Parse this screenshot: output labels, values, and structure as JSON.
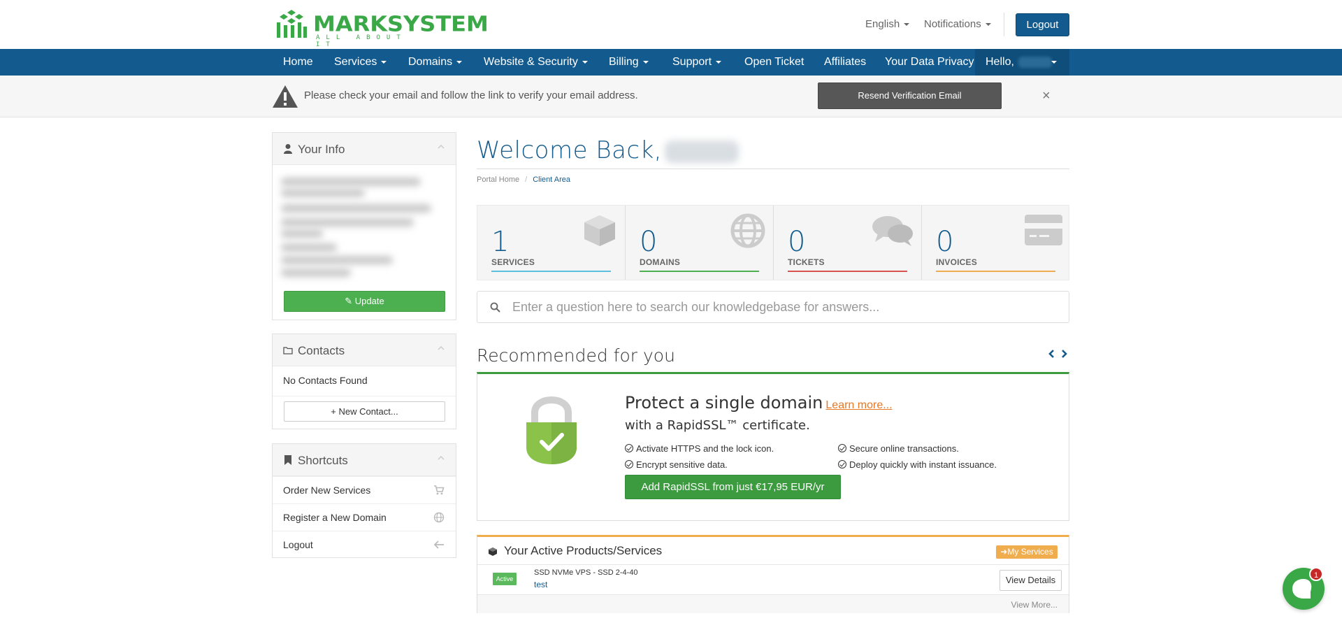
{
  "brand": {
    "logo_text": "MARKSYSTEM",
    "tagline": "ALL ABOUT IT",
    "primary_color": "#135b8e",
    "accent_green": "#3aa846"
  },
  "topbar": {
    "language": "English",
    "notifications": "Notifications",
    "logout": "Logout"
  },
  "nav": {
    "items": [
      {
        "label": "Home",
        "dropdown": false
      },
      {
        "label": "Services",
        "dropdown": true
      },
      {
        "label": "Domains",
        "dropdown": true
      },
      {
        "label": "Website & Security",
        "dropdown": true
      },
      {
        "label": "Billing",
        "dropdown": true
      },
      {
        "label": "Support",
        "dropdown": true
      },
      {
        "label": "Open Ticket",
        "dropdown": false
      },
      {
        "label": "Affiliates",
        "dropdown": false
      },
      {
        "label": "Your Data Privacy",
        "dropdown": false
      }
    ],
    "hello": "Hello,"
  },
  "alert": {
    "icon": "warning-icon",
    "message": "Please check your email and follow the link to verify your email address.",
    "resend_button": "Resend Verification Email",
    "close": "×"
  },
  "sidebar": {
    "your_info": {
      "title": "Your Info",
      "icon": "user-icon",
      "update_button": "Update"
    },
    "contacts": {
      "title": "Contacts",
      "icon": "folder-icon",
      "empty_text": "No Contacts Found",
      "new_contact_button": "New Contact..."
    },
    "shortcuts": {
      "title": "Shortcuts",
      "icon": "bookmark-icon",
      "items": [
        {
          "label": "Order New Services",
          "icon": "cart-icon"
        },
        {
          "label": "Register a New Domain",
          "icon": "globe-icon"
        },
        {
          "label": "Logout",
          "icon": "arrow-left-icon"
        }
      ]
    }
  },
  "main": {
    "welcome": "Welcome Back,",
    "breadcrumb": [
      "Portal Home",
      "Client Area"
    ],
    "stats": [
      {
        "value": "1",
        "label": "SERVICES",
        "icon": "cube-icon",
        "color": "#5bc0de"
      },
      {
        "value": "0",
        "label": "DOMAINS",
        "icon": "globe-icon",
        "color": "#4caf50"
      },
      {
        "value": "0",
        "label": "TICKETS",
        "icon": "comments-icon",
        "color": "#d9534f"
      },
      {
        "value": "0",
        "label": "INVOICES",
        "icon": "credit-card-icon",
        "color": "#f0ad4e"
      }
    ],
    "kb_search_placeholder": "Enter a question here to search our knowledgebase for answers...",
    "recommended": {
      "title": "Recommended for you",
      "headline": "Protect a single domain",
      "learn_more": "Learn more...",
      "subheadline": "with a RapidSSL™ certificate.",
      "features": [
        "Activate HTTPS and the lock icon.",
        "Secure online transactions.",
        "Encrypt sensitive data.",
        "Deploy quickly with instant issuance."
      ],
      "cta": "Add RapidSSL from just €17,95 EUR/yr"
    },
    "products": {
      "title": "Your Active Products/Services",
      "my_services_button": "My Services",
      "items": [
        {
          "status": "Active",
          "name": "SSD NVMe VPS - SSD 2-4-40",
          "domain": "test",
          "action": "View Details"
        }
      ],
      "view_more": "View More..."
    }
  },
  "chat": {
    "badge": "1"
  }
}
